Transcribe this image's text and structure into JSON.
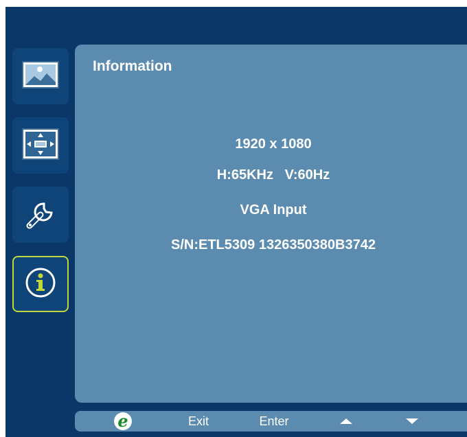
{
  "sidebar": {
    "items": [
      {
        "icon": "picture-icon",
        "active": false
      },
      {
        "icon": "display-position-icon",
        "active": false
      },
      {
        "icon": "settings-wrench-icon",
        "active": false
      },
      {
        "icon": "information-icon",
        "active": true
      }
    ]
  },
  "panel": {
    "title": "Information",
    "resolution": "1920 x 1080",
    "frequency": "H:65KHz   V:60Hz",
    "input": "VGA Input",
    "serial": "S/N:ETL5309 1326350380B3742"
  },
  "footer": {
    "logo_glyph": "e",
    "exit_label": "Exit",
    "enter_label": "Enter",
    "up_icon": "arrow-up-icon",
    "down_icon": "arrow-down-icon"
  },
  "colors": {
    "frame": "#0b3768",
    "panel": "#5b8bae",
    "active_border": "#c2d73a",
    "logo_green": "#1c8a28"
  }
}
